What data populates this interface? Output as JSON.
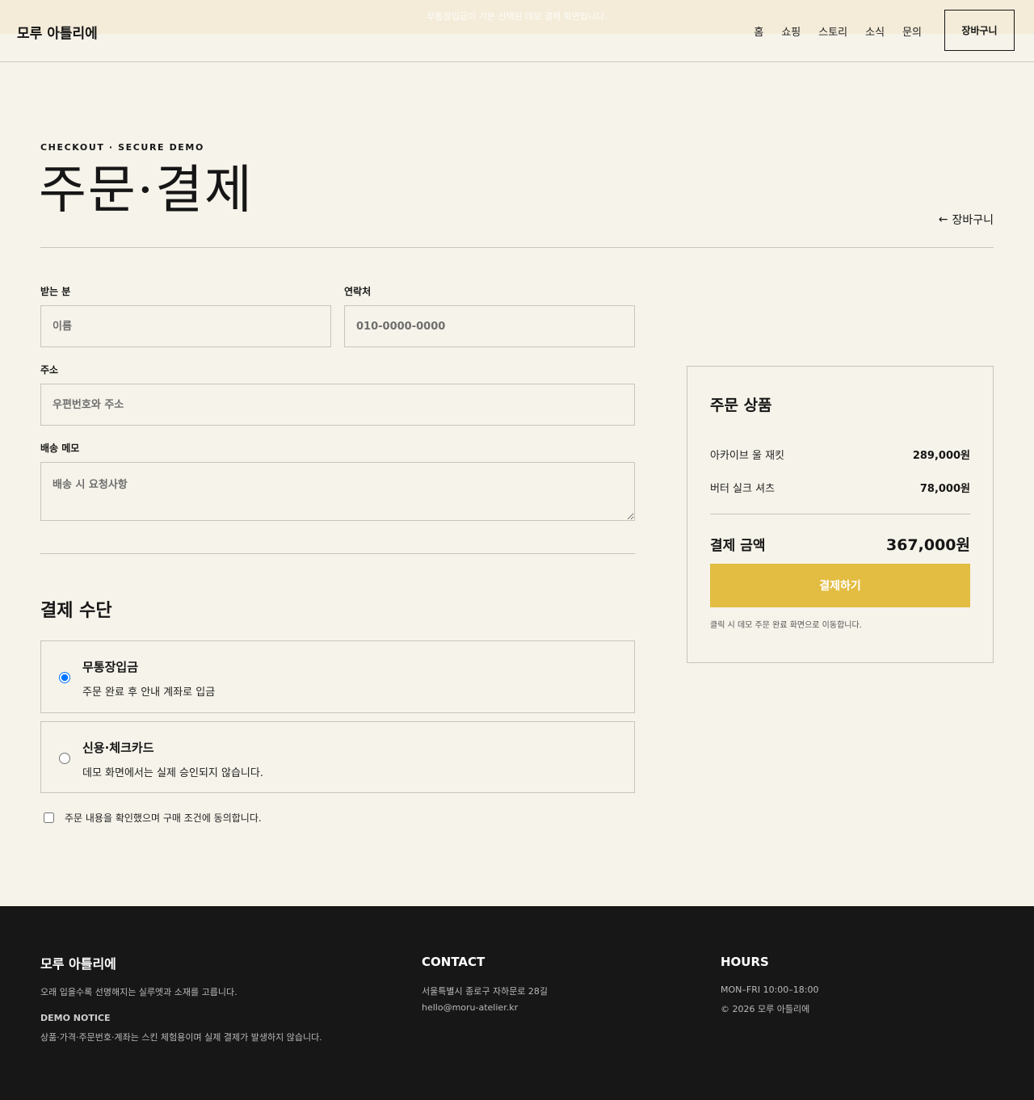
{
  "announcement": "무통장입금이 기본 선택된 데모 결제 화면입니다.",
  "header": {
    "logo": "모루 아틀리에",
    "nav": [
      "홈",
      "쇼핑",
      "스토리",
      "소식",
      "문의"
    ],
    "cart_button": "장바구니"
  },
  "page": {
    "eyebrow": "CHECKOUT · SECURE DEMO",
    "title": "주문·결제",
    "back_link": "장바구니"
  },
  "form": {
    "recipient_label": "받는 분",
    "recipient_placeholder": "이름",
    "phone_label": "연락처",
    "phone_placeholder": "010-0000-0000",
    "address_label": "주소",
    "address_placeholder": "우편번호와 주소",
    "memo_label": "배송 메모",
    "memo_placeholder": "배송 시 요청사항"
  },
  "payment": {
    "title": "결제 수단",
    "options": [
      {
        "title": "무통장입금",
        "desc": "주문 완료 후 안내 계좌로 입금",
        "selected": true
      },
      {
        "title": "신용·체크카드",
        "desc": "데모 화면에서는 실제 승인되지 않습니다.",
        "selected": false
      }
    ],
    "agree_text": "주문 내용을 확인했으며 구매 조건에 동의합니다."
  },
  "summary": {
    "title": "주문 상품",
    "items": [
      {
        "name": "아카이브 울 재킷",
        "price": "289,000원"
      },
      {
        "name": "버터 실크 셔츠",
        "price": "78,000원"
      }
    ],
    "total_label": "결제 금액",
    "total_value": "367,000원",
    "pay_button": "결제하기",
    "note": "클릭 시 데모 주문 완료 화면으로 이동합니다."
  },
  "footer": {
    "logo": "모루 아틀리에",
    "tagline": "오래 입을수록 선명해지는 실루엣과 소재를 고릅니다.",
    "notice_heading": "DEMO NOTICE",
    "notice_text": "상품·가격·주문번호·계좌는 스킨 체험용이며 실제 결제가 발생하지 않습니다.",
    "contact_heading": "CONTACT",
    "address": "서울특별시 종로구 자하문로 28길",
    "email": "hello@moru-atelier.kr",
    "hours_heading": "HOURS",
    "hours": "MON–FRI 10:00–18:00",
    "copyright": "© 2026 모루 아틀리에"
  },
  "colors": {
    "background": "#f6f3ea",
    "accent": "#e3bd42",
    "footer": "#171717",
    "text": "#161616"
  }
}
